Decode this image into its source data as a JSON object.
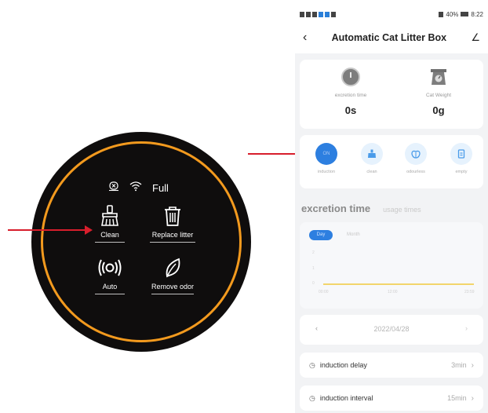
{
  "panel": {
    "status_text": "Full",
    "controls": [
      {
        "label": "Clean"
      },
      {
        "label": "Replace litter"
      },
      {
        "label": "Auto"
      },
      {
        "label": "Remove odor"
      }
    ]
  },
  "phone": {
    "statusbar": {
      "battery": "40%",
      "time": "8:22"
    },
    "nav": {
      "back_glyph": "‹",
      "title": "Automatic Cat Litter Box",
      "edit_glyph": "∠"
    },
    "stats": [
      {
        "label": "excretion time",
        "value": "0s"
      },
      {
        "label": "Cat Weight",
        "value": "0g"
      }
    ],
    "modes": [
      {
        "label": "induction",
        "circle_text": "ON",
        "active": true
      },
      {
        "label": "clean"
      },
      {
        "label": "odourless"
      },
      {
        "label": "empty"
      }
    ],
    "tabs": {
      "active": "excretion time",
      "inactive": "usage times"
    },
    "chart": {
      "pills": {
        "day": "Day",
        "month": "Month"
      },
      "x_labels": [
        "00:00",
        "12:00",
        "23:59"
      ],
      "y_labels": [
        "2",
        "1",
        "0"
      ]
    },
    "date": {
      "prev": "‹",
      "value": "2022/04/28",
      "next": "›"
    },
    "settings": [
      {
        "label": "induction delay",
        "value": "3min"
      },
      {
        "label": "induction interval",
        "value": "15min"
      }
    ],
    "colors": {
      "accent": "#2d7fe0",
      "ring": "#f39a1e",
      "arrow": "#d81e2c"
    }
  }
}
